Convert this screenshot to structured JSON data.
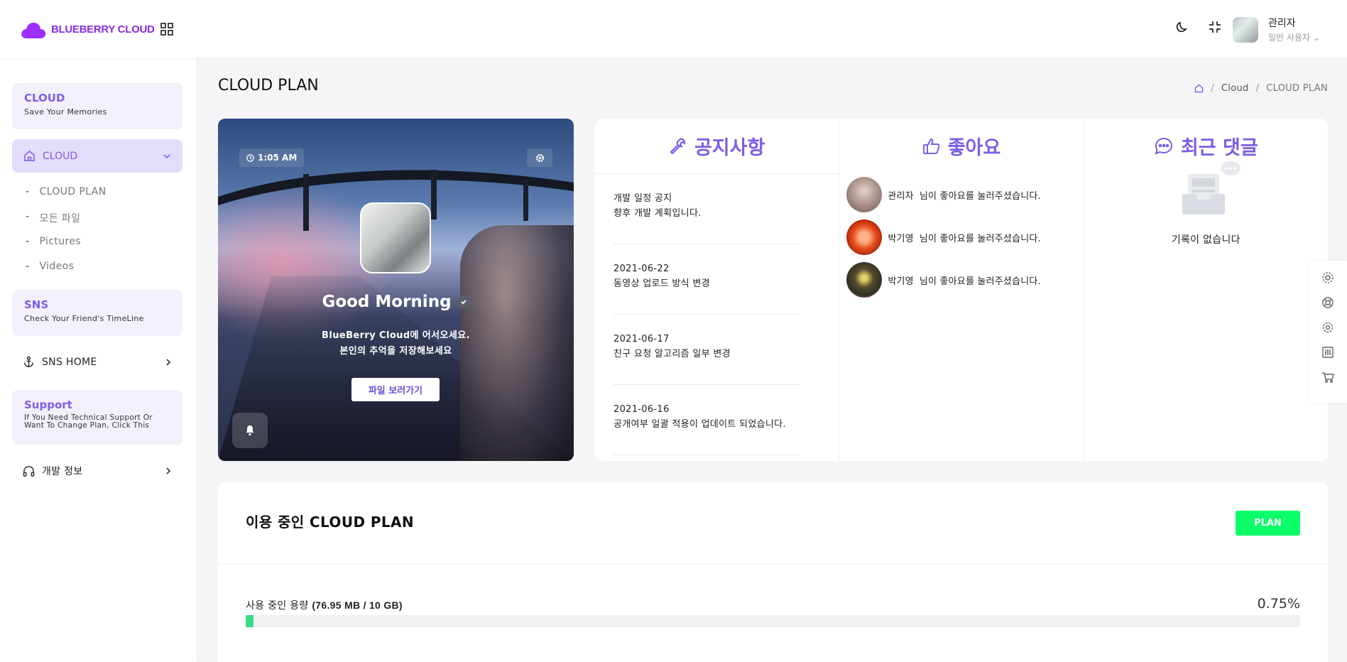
{
  "brand": {
    "name": "BLUEBERRY CLOUD"
  },
  "sidebar": {
    "cloud_section": {
      "title": "CLOUD",
      "subtitle": "Save Your Memories"
    },
    "cloud_menu": {
      "label": "CLOUD",
      "expanded": true
    },
    "cloud_items": [
      "CLOUD PLAN",
      "모든 파일",
      "Pictures",
      "Videos"
    ],
    "sns_section": {
      "title": "SNS",
      "subtitle": "Check Your Friend's TimeLine"
    },
    "sns_home": {
      "label": "SNS HOME"
    },
    "support_section": {
      "title": "Support",
      "subtitle": "If You Need Technical Support Or Want To Change Plan, Click This"
    },
    "dev_info": {
      "label": "개발 정보"
    }
  },
  "topbar": {
    "user_name": "관리자",
    "user_role": "일반 사용자"
  },
  "page": {
    "title": "CLOUD PLAN",
    "breadcrumb": [
      "Cloud",
      "CLOUD PLAN"
    ]
  },
  "hero": {
    "time": "1:05 AM",
    "greeting": "Good Morning",
    "line1": "BlueBerry Cloud에 어서오세요.",
    "line2": "본인의 추억을 저장해보세요",
    "button": "파일 보러가기"
  },
  "notices": {
    "title": "공지사항",
    "items": [
      {
        "date": "개발 일정 공지",
        "text": "향후 개발 계획입니다."
      },
      {
        "date": "2021-06-22",
        "text": "동영상 업로드 방식 변경"
      },
      {
        "date": "2021-06-17",
        "text": "친구 요청 알고리즘 일부 변경"
      },
      {
        "date": "2021-06-16",
        "text": "공개여부 일괄 적용이 업데이트 되었습니다."
      }
    ]
  },
  "likes": {
    "title": "좋아요",
    "items": [
      {
        "name": "관리자",
        "text": "님이 좋아요를 눌러주셨습니다."
      },
      {
        "name": "박기영",
        "text": "님이 좋아요를 눌러주셨습니다."
      },
      {
        "name": "박기영",
        "text": "님이 좋아요를 눌러주셨습니다."
      }
    ]
  },
  "comments": {
    "title": "최근 댓글",
    "empty": "기록이 없습니다"
  },
  "plan": {
    "title": "이용 중인 CLOUD PLAN",
    "badge": "PLAN",
    "usage_prefix": "사용 중인 용량 ",
    "usage_value": "(76.95 MB / 10 GB)",
    "percent_label": "0.75%",
    "percent": 0.75
  },
  "colors": {
    "accent": "#7b5ee8",
    "brand": "#8a2be2",
    "plan_badge": "#0aff68",
    "progress": "#3ddc84"
  }
}
